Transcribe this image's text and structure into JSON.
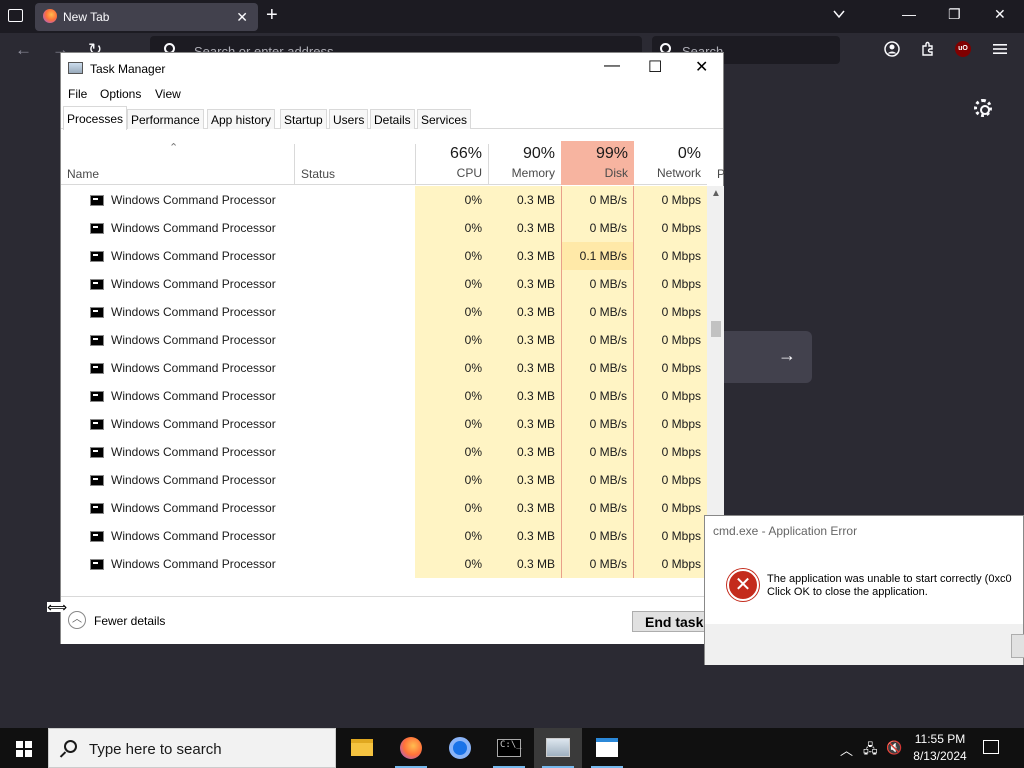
{
  "browser": {
    "tab_title": "New Tab",
    "tab_close": "✕",
    "new_tab": "+",
    "url_placeholder": "Search or enter address",
    "search_placeholder": "Search",
    "back": "←",
    "forward": "→",
    "reload": "↻",
    "go_arrow": "→",
    "minimize": "—",
    "restore": "❐",
    "close": "✕",
    "ublock_label": "uO"
  },
  "task_manager": {
    "title": "Task Manager",
    "minimize": "—",
    "maximize": "☐",
    "close": "✕",
    "menu": [
      "File",
      "Options",
      "View"
    ],
    "tabs": [
      "Processes",
      "Performance",
      "App history",
      "Startup",
      "Users",
      "Details",
      "Services"
    ],
    "active_tab": "Processes",
    "columns": {
      "name": "Name",
      "status": "Status",
      "cpu": {
        "pct": "66%",
        "label": "CPU"
      },
      "memory": {
        "pct": "90%",
        "label": "Memory"
      },
      "disk": {
        "pct": "99%",
        "label": "Disk"
      },
      "network": {
        "pct": "0%",
        "label": "Network"
      },
      "extra": "P"
    },
    "rows": [
      {
        "name": "Windows Command Processor",
        "cpu": "0%",
        "memory": "0.3 MB",
        "disk": "0 MB/s",
        "network": "0 Mbps"
      },
      {
        "name": "Windows Command Processor",
        "cpu": "0%",
        "memory": "0.3 MB",
        "disk": "0 MB/s",
        "network": "0 Mbps"
      },
      {
        "name": "Windows Command Processor",
        "cpu": "0%",
        "memory": "0.3 MB",
        "disk": "0.1 MB/s",
        "network": "0 Mbps"
      },
      {
        "name": "Windows Command Processor",
        "cpu": "0%",
        "memory": "0.3 MB",
        "disk": "0 MB/s",
        "network": "0 Mbps"
      },
      {
        "name": "Windows Command Processor",
        "cpu": "0%",
        "memory": "0.3 MB",
        "disk": "0 MB/s",
        "network": "0 Mbps"
      },
      {
        "name": "Windows Command Processor",
        "cpu": "0%",
        "memory": "0.3 MB",
        "disk": "0 MB/s",
        "network": "0 Mbps"
      },
      {
        "name": "Windows Command Processor",
        "cpu": "0%",
        "memory": "0.3 MB",
        "disk": "0 MB/s",
        "network": "0 Mbps"
      },
      {
        "name": "Windows Command Processor",
        "cpu": "0%",
        "memory": "0.3 MB",
        "disk": "0 MB/s",
        "network": "0 Mbps"
      },
      {
        "name": "Windows Command Processor",
        "cpu": "0%",
        "memory": "0.3 MB",
        "disk": "0 MB/s",
        "network": "0 Mbps"
      },
      {
        "name": "Windows Command Processor",
        "cpu": "0%",
        "memory": "0.3 MB",
        "disk": "0 MB/s",
        "network": "0 Mbps"
      },
      {
        "name": "Windows Command Processor",
        "cpu": "0%",
        "memory": "0.3 MB",
        "disk": "0 MB/s",
        "network": "0 Mbps"
      },
      {
        "name": "Windows Command Processor",
        "cpu": "0%",
        "memory": "0.3 MB",
        "disk": "0 MB/s",
        "network": "0 Mbps"
      },
      {
        "name": "Windows Command Processor",
        "cpu": "0%",
        "memory": "0.3 MB",
        "disk": "0 MB/s",
        "network": "0 Mbps"
      },
      {
        "name": "Windows Command Processor",
        "cpu": "0%",
        "memory": "0.3 MB",
        "disk": "0 MB/s",
        "network": "0 Mbps"
      }
    ],
    "fewer_details": "Fewer details",
    "end_task": "End task",
    "colors": {
      "disk_header": "#f7b4a0",
      "cell_heat": "#fff4c4"
    }
  },
  "error_dialog": {
    "title": "cmd.exe - Application Error",
    "message_line1": "The application was unable to start correctly (0xc0",
    "message_line2": "Click OK to close the application.",
    "icon": "error-icon",
    "icon_glyph": "✕"
  },
  "taskbar": {
    "search_placeholder": "Type here to search",
    "time": "11:55 PM",
    "date": "8/13/2024",
    "cmd_glyph": "C:\\_"
  }
}
